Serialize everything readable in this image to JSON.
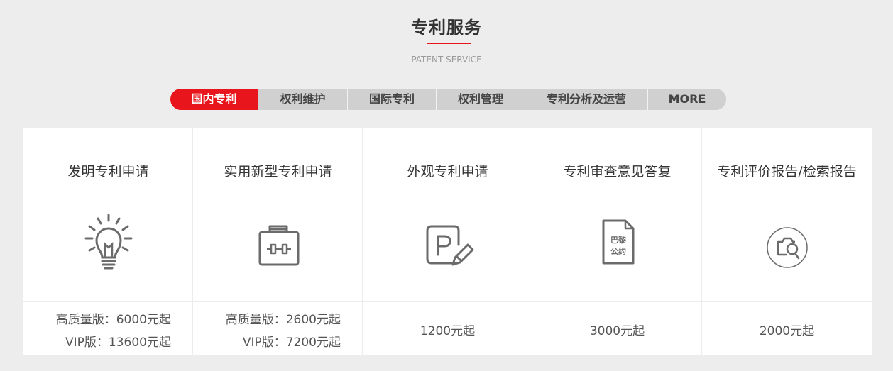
{
  "header": {
    "title": "专利服务",
    "subtitle": "PATENT SERVICE",
    "accent_color": "#e8151c"
  },
  "tabs": [
    {
      "label": "国内专利",
      "active": true
    },
    {
      "label": "权利维护",
      "active": false
    },
    {
      "label": "国际专利",
      "active": false
    },
    {
      "label": "权利管理",
      "active": false
    },
    {
      "label": "专利分析及运营",
      "active": false
    },
    {
      "label": "MORE",
      "active": false
    }
  ],
  "cards": [
    {
      "name": "发明专利申请",
      "icon": "lightbulb-icon",
      "price_lines": [
        "高质量版：6000元起",
        "VIP版：13600元起"
      ]
    },
    {
      "name": "实用新型专利申请",
      "icon": "toolbox-icon",
      "price_lines": [
        "高质量版：2600元起",
        "VIP版：7200元起"
      ]
    },
    {
      "name": "外观专利申请",
      "icon": "pencil-p-icon",
      "price": "1200元起"
    },
    {
      "name": "专利审查意见答复",
      "icon": "paris-convention-document-icon",
      "icon_text": [
        "巴黎",
        "公约"
      ],
      "price": "3000元起"
    },
    {
      "name": "专利评价报告/检索报告",
      "icon": "search-report-icon",
      "price": "2000元起"
    }
  ]
}
